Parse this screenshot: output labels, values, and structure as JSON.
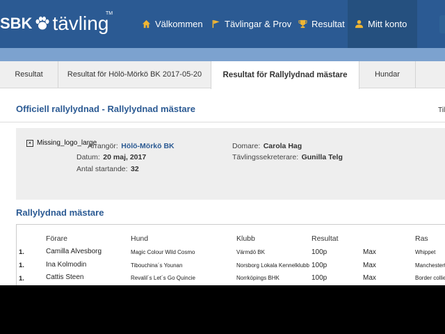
{
  "header": {
    "logo_sbk": "SBK",
    "logo_tavling": "tävling",
    "logo_tm": "TM",
    "nav": [
      {
        "label": "Välkommen",
        "icon": "home-icon"
      },
      {
        "label": "Tävlingar & Prov",
        "icon": "flag-icon"
      },
      {
        "label": "Resultat",
        "icon": "trophy-icon"
      },
      {
        "label": "Mitt konto",
        "icon": "user-icon"
      }
    ]
  },
  "tabs": [
    {
      "label": "Resultat"
    },
    {
      "label": "Resultat för Hölö-Mörkö BK 2017-05-20"
    },
    {
      "label": "Resultat för Rallylydnad mästare",
      "active": true
    },
    {
      "label": "Hundar"
    }
  ],
  "section": {
    "title": "Officiell rallylydnad - Rallylydnad mästare",
    "right_text": "Til"
  },
  "info": {
    "logo_alt": "Missing_logo_large",
    "arrangor_label": "Arrangör:",
    "arrangor_value": "Hölö-Mörkö BK",
    "datum_label": "Datum:",
    "datum_value": "20 maj, 2017",
    "antal_label": "Antal startande:",
    "antal_value": "32",
    "domare_label": "Domare:",
    "domare_value": "Carola Hag",
    "sekreterare_label": "Tävlingssekreterare:",
    "sekreterare_value": "Gunilla Telg"
  },
  "results": {
    "title": "Rallylydnad mästare",
    "columns": [
      "Förare",
      "Hund",
      "Klubb",
      "Resultat",
      "Ras"
    ],
    "rows": [
      {
        "place": "1.",
        "forare": "Camilla Alvesborg",
        "hund": "Magic Colour Wild Cosmo",
        "klubb": "Värmdö BK",
        "resultat": "100p",
        "max": "Max",
        "ras": "Whippet"
      },
      {
        "place": "1.",
        "forare": "Ina Kolmodin",
        "hund": "Tibouchina´s Younan",
        "klubb": "Norsborg Lokala Kennelklubb",
        "resultat": "100p",
        "max": "Max",
        "ras": "Manchesterte"
      },
      {
        "place": "1.",
        "forare": "Cattis Steen",
        "hund": "Revalil´s Let´s Go Quincie",
        "klubb": "Norrköpings BHK",
        "resultat": "100p",
        "max": "Max",
        "ras": "Border collie"
      }
    ]
  },
  "colors": {
    "brand": "#2b5a93",
    "subbar": "#7ca2cf",
    "accent": "#f2b632"
  }
}
